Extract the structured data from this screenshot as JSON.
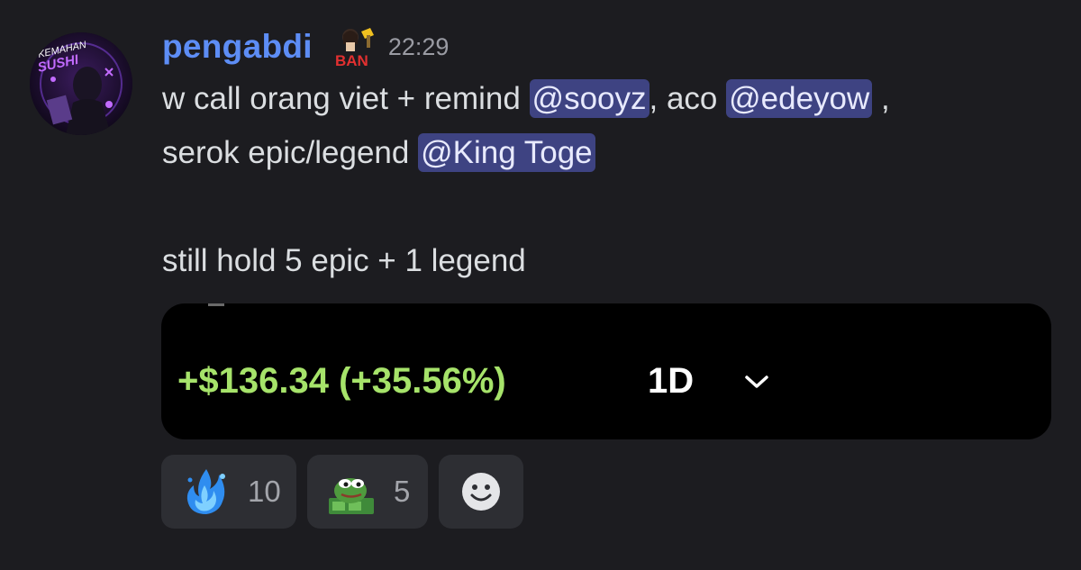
{
  "message": {
    "author": "pengabdi",
    "badge_text": "BAN",
    "timestamp": "22:29",
    "avatar_text_top": "KEMAHAN",
    "avatar_text_mid": "SUSHI",
    "lines": {
      "l1_a": "w call orang viet + remind ",
      "l1_mention1": "@sooyz",
      "l1_b": ", aco ",
      "l1_mention2": "@edeyow",
      "l1_c": " ,",
      "l2_a": "serok epic/legend ",
      "l2_mention": "@King Toge",
      "l3": "still hold 5 epic + 1 legend"
    }
  },
  "embed": {
    "pnl_text": "+$136.34 (+35.56%)",
    "period": "1D",
    "pnl_color": "#a6e36a"
  },
  "reactions": [
    {
      "emoji": "blue-fire-emoji",
      "count": "10"
    },
    {
      "emoji": "pepe-money-emoji",
      "count": "5"
    }
  ],
  "add_reaction_icon": "smiley-add-reaction-icon",
  "colors": {
    "background": "#1c1c20",
    "username": "#5d8df5",
    "mention_bg": "#3e4382",
    "reaction_bg": "#2d2e33"
  }
}
